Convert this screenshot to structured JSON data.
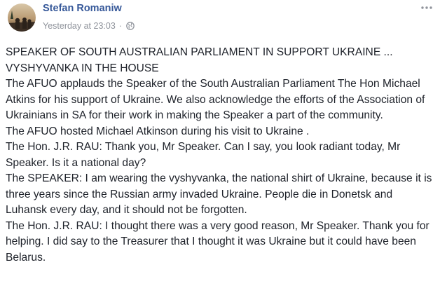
{
  "post": {
    "author": "Stefan Romaniw",
    "timestamp": "Yesterday at 23:03",
    "separator": "·",
    "privacy_icon": "globe-icon",
    "more_icon": "more-options-icon",
    "paragraphs_block1": [
      "SPEAKER OF SOUTH AUSTRALIAN PARLIAMENT IN SUPPORT UKRAINE ... VYSHYVANKA IN THE HOUSE",
      "The AFUO applauds the Speaker of the South Australian Parliament The Hon Michael Atkins for his support of Ukraine. We also acknowledge the efforts of the Association of Ukrainians in SA for their work in making the Speaker a part of the community.",
      "The AFUO hosted Michael Atkinson during his visit to Ukraine ."
    ],
    "paragraphs_block2": [
      "The Hon. J.R. RAU: Thank you, Mr Speaker. Can I say, you look radiant today, Mr Speaker. Is it a national day?",
      "The SPEAKER: I am wearing the vyshyvanka, the national shirt of Ukraine, because it is three years since the Russian army invaded Ukraine. People die in Donetsk and Luhansk every day, and it should not be forgotten.",
      "The Hon. J.R. RAU: I thought there was a very good reason, Mr Speaker. Thank you for helping. I did say to the Treasurer that I thought it was Ukraine but it could have been Belarus."
    ]
  },
  "colors": {
    "author_link": "#365899",
    "meta_text": "#90949c",
    "body_text": "#1d2129"
  }
}
